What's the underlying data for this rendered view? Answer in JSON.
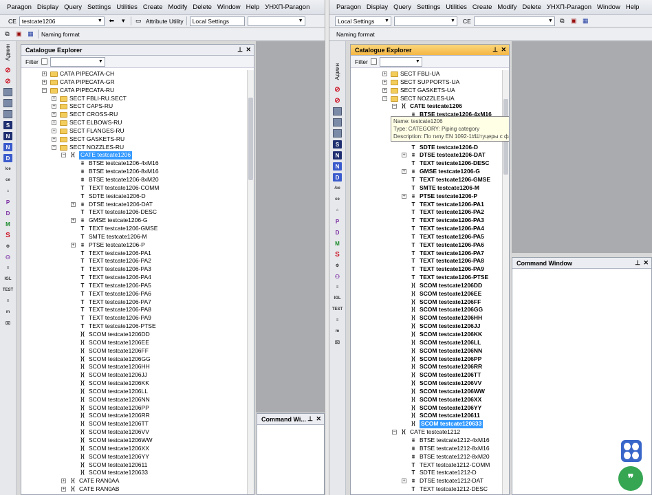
{
  "left": {
    "menu": [
      "Paragon",
      "Display",
      "Query",
      "Settings",
      "Utilities",
      "Create",
      "Modify",
      "Delete",
      "Window",
      "Help",
      "УНХП-Paragon"
    ],
    "toolbar": {
      "ce_label": "CE",
      "ce_value": "testcate1206",
      "attr_utility": "Attribute Utility",
      "local_settings": "Local Settings",
      "naming_format": "Naming format"
    },
    "sidebar_label": "Админ",
    "explorer": {
      "title": "Catalogue Explorer",
      "filter_label": "Filter",
      "tree": [
        {
          "label": "CATA PIPECATA-CH",
          "indent": 0,
          "icon": "folder",
          "exp": "+"
        },
        {
          "label": "CATA PIPECATA-GR",
          "indent": 0,
          "icon": "folder",
          "exp": "+"
        },
        {
          "label": "CATA PIPECATA-RU",
          "indent": 0,
          "icon": "folder",
          "exp": "-"
        },
        {
          "label": "SECT FBLI-RU.SECT",
          "indent": 1,
          "icon": "folder",
          "exp": "+"
        },
        {
          "label": "SECT CAPS-RU",
          "indent": 1,
          "icon": "folder",
          "exp": "+"
        },
        {
          "label": "SECT CROSS-RU",
          "indent": 1,
          "icon": "folder",
          "exp": "+"
        },
        {
          "label": "SECT ELBOWS-RU",
          "indent": 1,
          "icon": "folder",
          "exp": "+"
        },
        {
          "label": "SECT FLANGES-RU",
          "indent": 1,
          "icon": "folder",
          "exp": "+"
        },
        {
          "label": "SECT GASKETS-RU",
          "indent": 1,
          "icon": "folder",
          "exp": "+"
        },
        {
          "label": "SECT NOZZLES-RU",
          "indent": 1,
          "icon": "folder",
          "exp": "-"
        },
        {
          "label": "CATE testcate1206",
          "indent": 2,
          "icon": "cate",
          "exp": "-",
          "sel": true
        },
        {
          "label": "BTSE testcate1206-4xM16",
          "indent": 3,
          "icon": "tree"
        },
        {
          "label": "BTSE testcate1206-8xM16",
          "indent": 3,
          "icon": "tree"
        },
        {
          "label": "BTSE testcate1206-8xM20",
          "indent": 3,
          "icon": "tree"
        },
        {
          "label": "TEXT testcate1206-COMM",
          "indent": 3,
          "icon": "text"
        },
        {
          "label": "SDTE testcate1206-D",
          "indent": 3,
          "icon": "text"
        },
        {
          "label": "DTSE testcate1206-DAT",
          "indent": 3,
          "icon": "tree",
          "exp": "+"
        },
        {
          "label": "TEXT testcate1206-DESC",
          "indent": 3,
          "icon": "text"
        },
        {
          "label": "GMSE testcate1206-G",
          "indent": 3,
          "icon": "tree",
          "exp": "+"
        },
        {
          "label": "TEXT testcate1206-GMSE",
          "indent": 3,
          "icon": "text"
        },
        {
          "label": "SMTE testcate1206-M",
          "indent": 3,
          "icon": "text"
        },
        {
          "label": "PTSE testcate1206-P",
          "indent": 3,
          "icon": "tree",
          "exp": "+"
        },
        {
          "label": "TEXT testcate1206-PA1",
          "indent": 3,
          "icon": "text"
        },
        {
          "label": "TEXT testcate1206-PA2",
          "indent": 3,
          "icon": "text"
        },
        {
          "label": "TEXT testcate1206-PA3",
          "indent": 3,
          "icon": "text"
        },
        {
          "label": "TEXT testcate1206-PA4",
          "indent": 3,
          "icon": "text"
        },
        {
          "label": "TEXT testcate1206-PA5",
          "indent": 3,
          "icon": "text"
        },
        {
          "label": "TEXT testcate1206-PA6",
          "indent": 3,
          "icon": "text"
        },
        {
          "label": "TEXT testcate1206-PA7",
          "indent": 3,
          "icon": "text"
        },
        {
          "label": "TEXT testcate1206-PA8",
          "indent": 3,
          "icon": "text"
        },
        {
          "label": "TEXT testcate1206-PA9",
          "indent": 3,
          "icon": "text"
        },
        {
          "label": "TEXT testcate1206-PTSE",
          "indent": 3,
          "icon": "text"
        },
        {
          "label": "SCOM testcate1206DD",
          "indent": 3,
          "icon": "cate"
        },
        {
          "label": "SCOM testcate1206EE",
          "indent": 3,
          "icon": "cate"
        },
        {
          "label": "SCOM testcate1206FF",
          "indent": 3,
          "icon": "cate"
        },
        {
          "label": "SCOM testcate1206GG",
          "indent": 3,
          "icon": "cate"
        },
        {
          "label": "SCOM testcate1206HH",
          "indent": 3,
          "icon": "cate"
        },
        {
          "label": "SCOM testcate1206JJ",
          "indent": 3,
          "icon": "cate"
        },
        {
          "label": "SCOM testcate1206KK",
          "indent": 3,
          "icon": "cate"
        },
        {
          "label": "SCOM testcate1206LL",
          "indent": 3,
          "icon": "cate"
        },
        {
          "label": "SCOM testcate1206NN",
          "indent": 3,
          "icon": "cate"
        },
        {
          "label": "SCOM testcate1206PP",
          "indent": 3,
          "icon": "cate"
        },
        {
          "label": "SCOM testcate1206RR",
          "indent": 3,
          "icon": "cate"
        },
        {
          "label": "SCOM testcate1206TT",
          "indent": 3,
          "icon": "cate"
        },
        {
          "label": "SCOM testcate1206VV",
          "indent": 3,
          "icon": "cate"
        },
        {
          "label": "SCOM testcate1206WW",
          "indent": 3,
          "icon": "cate"
        },
        {
          "label": "SCOM testcate1206XX",
          "indent": 3,
          "icon": "cate"
        },
        {
          "label": "SCOM testcate1206YY",
          "indent": 3,
          "icon": "cate"
        },
        {
          "label": "SCOM testcate120611",
          "indent": 3,
          "icon": "cate"
        },
        {
          "label": "SCOM testcate120633",
          "indent": 3,
          "icon": "cate"
        },
        {
          "label": "CATE RAN0AA",
          "indent": 2,
          "icon": "cate",
          "exp": "+"
        },
        {
          "label": "CATE RAN0AB",
          "indent": 2,
          "icon": "cate",
          "exp": "+"
        }
      ]
    },
    "command_window": {
      "title": "Command Wi..."
    }
  },
  "right": {
    "menu": [
      "Paragon",
      "Display",
      "Query",
      "Settings",
      "Utilities",
      "Create",
      "Modify",
      "Delete",
      "УНХП-Paragon",
      "Window",
      "Help"
    ],
    "toolbar": {
      "local_settings": "Local Settings",
      "ce_label": "CE",
      "naming_format": "Naming format"
    },
    "sidebar_label": "Админ",
    "explorer": {
      "title": "Catalogue Explorer",
      "filter_label": "Filter",
      "tree": [
        {
          "label": "SECT FBLI-UA",
          "indent": 0,
          "icon": "folder",
          "exp": "+",
          "nb": true
        },
        {
          "label": "SECT SUPPORTS-UA",
          "indent": 0,
          "icon": "folder",
          "exp": "+",
          "nb": true
        },
        {
          "label": "SECT GASKETS-UA",
          "indent": 0,
          "icon": "folder",
          "exp": "+",
          "nb": true
        },
        {
          "label": "SECT NOZZLES-UA",
          "indent": 0,
          "icon": "folder",
          "exp": "-",
          "nb": true
        },
        {
          "label": "CATE testcate1206",
          "indent": 1,
          "icon": "cate",
          "exp": "-"
        },
        {
          "label": "BTSE testcate1206-4xM16",
          "indent": 2,
          "icon": "tree"
        },
        {
          "label": "",
          "indent": 2,
          "icon": "none"
        },
        {
          "label": "",
          "indent": 2,
          "icon": "none"
        },
        {
          "label": "",
          "indent": 2,
          "icon": "none"
        },
        {
          "label": "SDTE testcate1206-D",
          "indent": 2,
          "icon": "text"
        },
        {
          "label": "DTSE testcate1206-DAT",
          "indent": 2,
          "icon": "tree",
          "exp": "+"
        },
        {
          "label": "TEXT testcate1206-DESC",
          "indent": 2,
          "icon": "text"
        },
        {
          "label": "GMSE testcate1206-G",
          "indent": 2,
          "icon": "tree",
          "exp": "+"
        },
        {
          "label": "TEXT testcate1206-GMSE",
          "indent": 2,
          "icon": "text"
        },
        {
          "label": "SMTE testcate1206-M",
          "indent": 2,
          "icon": "text"
        },
        {
          "label": "PTSE testcate1206-P",
          "indent": 2,
          "icon": "tree",
          "exp": "+"
        },
        {
          "label": "TEXT testcate1206-PA1",
          "indent": 2,
          "icon": "text"
        },
        {
          "label": "TEXT testcate1206-PA2",
          "indent": 2,
          "icon": "text"
        },
        {
          "label": "TEXT testcate1206-PA3",
          "indent": 2,
          "icon": "text"
        },
        {
          "label": "TEXT testcate1206-PA4",
          "indent": 2,
          "icon": "text"
        },
        {
          "label": "TEXT testcate1206-PA5",
          "indent": 2,
          "icon": "text"
        },
        {
          "label": "TEXT testcate1206-PA6",
          "indent": 2,
          "icon": "text"
        },
        {
          "label": "TEXT testcate1206-PA7",
          "indent": 2,
          "icon": "text"
        },
        {
          "label": "TEXT testcate1206-PA8",
          "indent": 2,
          "icon": "text"
        },
        {
          "label": "TEXT testcate1206-PA9",
          "indent": 2,
          "icon": "text"
        },
        {
          "label": "TEXT testcate1206-PTSE",
          "indent": 2,
          "icon": "text"
        },
        {
          "label": "SCOM testcate1206DD",
          "indent": 2,
          "icon": "cate"
        },
        {
          "label": "SCOM testcate1206EE",
          "indent": 2,
          "icon": "cate"
        },
        {
          "label": "SCOM testcate1206FF",
          "indent": 2,
          "icon": "cate"
        },
        {
          "label": "SCOM testcate1206GG",
          "indent": 2,
          "icon": "cate"
        },
        {
          "label": "SCOM testcate1206HH",
          "indent": 2,
          "icon": "cate"
        },
        {
          "label": "SCOM testcate1206JJ",
          "indent": 2,
          "icon": "cate"
        },
        {
          "label": "SCOM testcate1206KK",
          "indent": 2,
          "icon": "cate"
        },
        {
          "label": "SCOM testcate1206LL",
          "indent": 2,
          "icon": "cate"
        },
        {
          "label": "SCOM testcate1206NN",
          "indent": 2,
          "icon": "cate"
        },
        {
          "label": "SCOM testcate1206PP",
          "indent": 2,
          "icon": "cate"
        },
        {
          "label": "SCOM testcate1206RR",
          "indent": 2,
          "icon": "cate"
        },
        {
          "label": "SCOM testcate1206TT",
          "indent": 2,
          "icon": "cate"
        },
        {
          "label": "SCOM testcate1206VV",
          "indent": 2,
          "icon": "cate"
        },
        {
          "label": "SCOM testcate1206WW",
          "indent": 2,
          "icon": "cate"
        },
        {
          "label": "SCOM testcate1206XX",
          "indent": 2,
          "icon": "cate"
        },
        {
          "label": "SCOM testcate1206YY",
          "indent": 2,
          "icon": "cate"
        },
        {
          "label": "SCOM testcate120611",
          "indent": 2,
          "icon": "cate"
        },
        {
          "label": "SCOM testcate120633",
          "indent": 2,
          "icon": "cate",
          "sel": true
        },
        {
          "label": "CATE testcate1212",
          "indent": 1,
          "icon": "cate",
          "exp": "-",
          "nb": true
        },
        {
          "label": "BTSE testcate1212-4xM16",
          "indent": 2,
          "icon": "tree",
          "nb": true
        },
        {
          "label": "BTSE testcate1212-8xM16",
          "indent": 2,
          "icon": "tree",
          "nb": true
        },
        {
          "label": "BTSE testcate1212-8xM20",
          "indent": 2,
          "icon": "tree",
          "nb": true
        },
        {
          "label": "TEXT testcate1212-COMM",
          "indent": 2,
          "icon": "text",
          "nb": true
        },
        {
          "label": "SDTE testcate1212-D",
          "indent": 2,
          "icon": "text",
          "nb": true
        },
        {
          "label": "DTSE testcate1212-DAT",
          "indent": 2,
          "icon": "tree",
          "exp": "+",
          "nb": true
        },
        {
          "label": "TEXT testcate1212-DESC",
          "indent": 2,
          "icon": "text",
          "nb": true
        }
      ],
      "tooltip": {
        "name": "Name: testcate1206",
        "type": "Type: CATEGORY: Piping category",
        "description": "Description: По типу EN 1092-1#Штуцеры с фланцами#на PN 4,0 МПа. исп.E"
      }
    },
    "command_window": {
      "title": "Command Window"
    }
  },
  "colors": {
    "selection": "#3399ff",
    "active_title": "#f5b745",
    "fab_users": "#3966c9",
    "fab_chat": "#36a653"
  }
}
